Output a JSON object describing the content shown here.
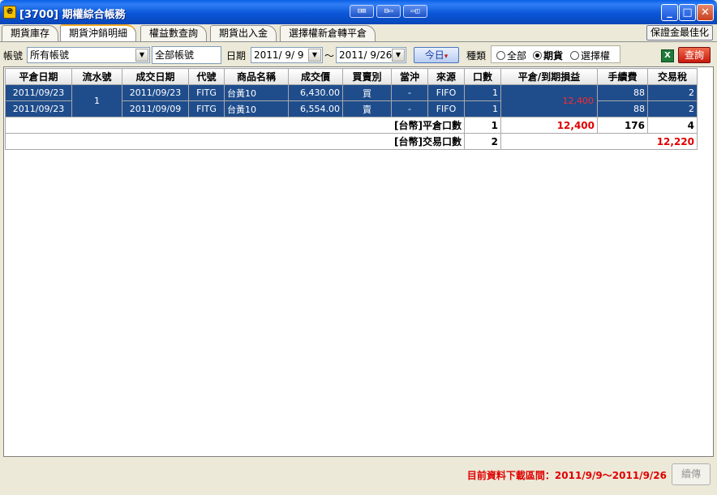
{
  "window": {
    "title": "[3700] 期權綜合帳務",
    "mid_buttons": [
      "⊟⊞",
      "⊟▭",
      "▭◫"
    ],
    "minimize": "_",
    "maximize": "□",
    "close": "✕"
  },
  "tabs": [
    {
      "label": "期貨庫存",
      "active": false
    },
    {
      "label": "期貨沖銷明細",
      "active": true
    },
    {
      "label": "權益數查詢",
      "active": false
    },
    {
      "label": "期貨出入金",
      "active": false
    },
    {
      "label": "選擇權新倉轉平倉",
      "active": false
    }
  ],
  "optimize_button": "保證金最佳化",
  "filters": {
    "account_label": "帳號",
    "account_value": "所有帳號",
    "account_name": "全部帳號",
    "date_label": "日期",
    "date_from": "2011/ 9/ 9",
    "date_sep": "～",
    "date_to": "2011/ 9/26",
    "today_button": "今日",
    "type_label": "種類",
    "type_options": [
      "全部",
      "期貨",
      "選擇權"
    ],
    "type_selected": "期貨",
    "query_button": "查詢"
  },
  "table": {
    "columns": [
      "平倉日期",
      "流水號",
      "成交日期",
      "代號",
      "商品名稱",
      "成交價",
      "買賣別",
      "當沖",
      "來源",
      "口數",
      "平倉/到期損益",
      "手續費",
      "交易稅"
    ],
    "rows": [
      {
        "close_date": "2011/09/23",
        "serial": "1",
        "trade_date": "2011/09/23",
        "code": "FITG",
        "product": "台黃10",
        "price": "6,430.00",
        "side": "買",
        "daytrade": "-",
        "source": "FIFO",
        "qty": "1",
        "pnl": "12,400",
        "fee": "88",
        "tax": "2"
      },
      {
        "close_date": "2011/09/23",
        "serial": "1",
        "trade_date": "2011/09/09",
        "code": "FITG",
        "product": "台黃10",
        "price": "6,554.00",
        "side": "賣",
        "daytrade": "-",
        "source": "FIFO",
        "qty": "1",
        "pnl": "12,400",
        "fee": "88",
        "tax": "2"
      }
    ],
    "summary_close": {
      "label": "[台幣]平倉口數",
      "qty": "1",
      "pnl": "12,400",
      "fee": "176",
      "tax": "4"
    },
    "summary_trade": {
      "label": "[台幣]交易口數",
      "qty": "2",
      "total": "12,220"
    }
  },
  "footer": {
    "range_text": "目前資料下載區間：2011/9/9～2011/9/26",
    "next_button": "續傳"
  }
}
